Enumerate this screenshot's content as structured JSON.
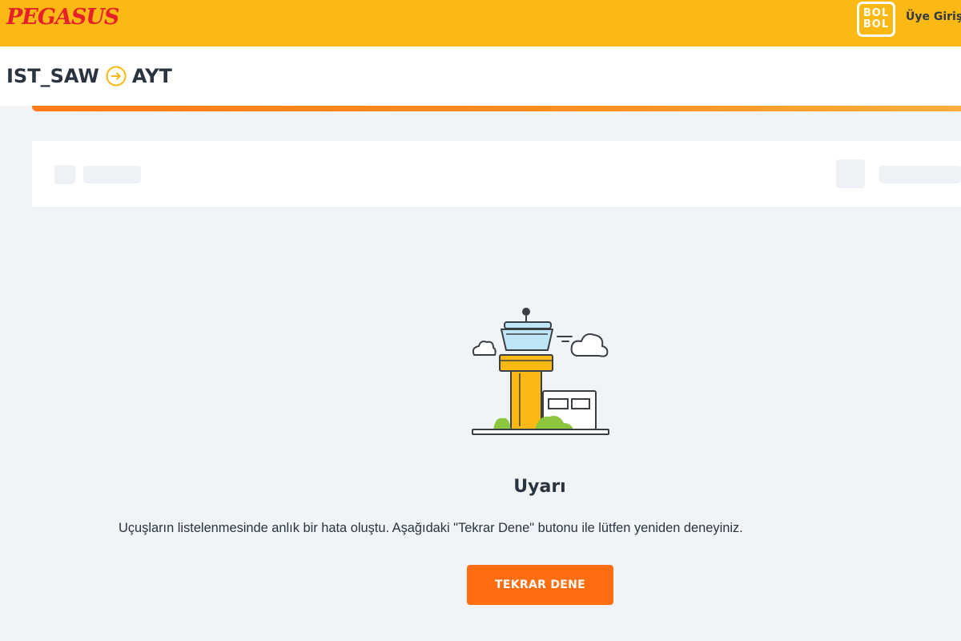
{
  "header": {
    "logo_text": "PEGASUS",
    "bolbol_line1": "BOL",
    "bolbol_line2": "BOL",
    "login_label": "Üye Giriş"
  },
  "route": {
    "origin": "IST_SAW",
    "destination": "AYT",
    "arrow_icon": "arrow-right-circle-icon"
  },
  "error": {
    "illustration_icon": "control-tower-icon",
    "title": "Uyarı",
    "message": "Uçuşların listelenmesinde anlık bir hata oluştu. Aşağıdaki \"Tekrar Dene\" butonu ile lütfen yeniden deneyiniz.",
    "retry_label": "TEKRAR DENE"
  },
  "colors": {
    "header_bg": "#fdb913",
    "brand_red": "#e5202a",
    "accent_orange": "#fe6d10",
    "page_bg": "#f1f4f7"
  }
}
